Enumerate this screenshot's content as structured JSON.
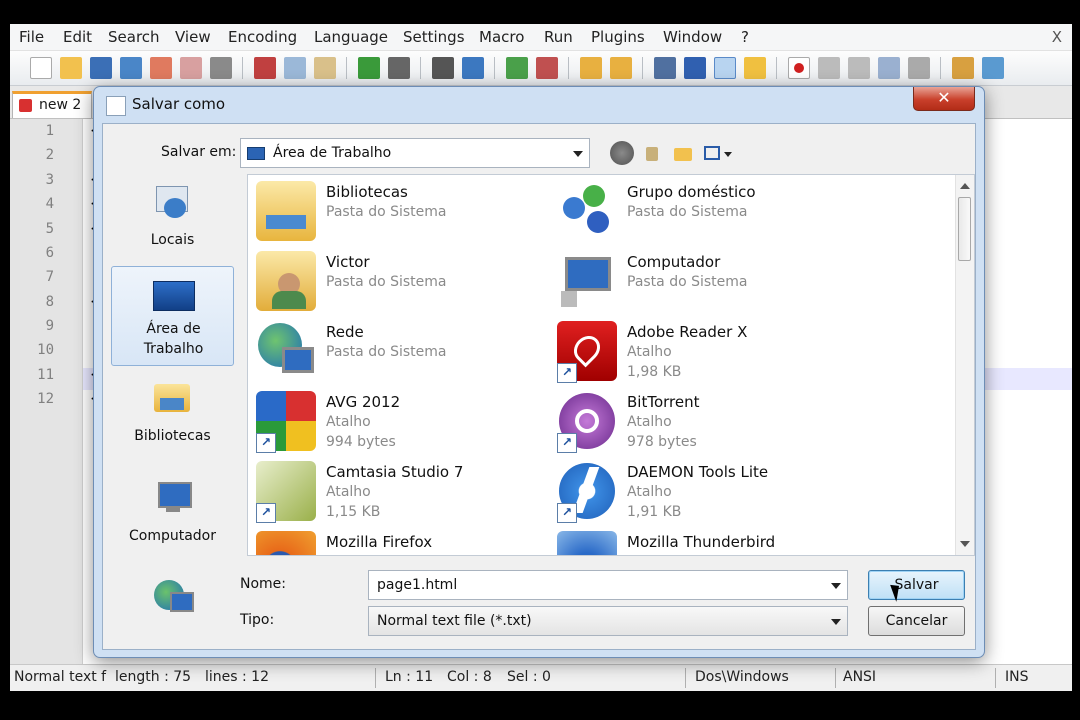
{
  "app": {
    "menu": [
      "File",
      "Edit",
      "Search",
      "View",
      "Encoding",
      "Language",
      "Settings",
      "Macro",
      "Run",
      "Plugins",
      "Window",
      "?"
    ],
    "close_glyph": "X",
    "tab_label": "new 2",
    "line_numbers": [
      "1",
      "2",
      "3",
      "4",
      "5",
      "6",
      "7",
      "8",
      "9",
      "10",
      "11",
      "12"
    ],
    "code_marks": [
      "<",
      "<",
      "<",
      "<",
      "<",
      "<",
      "<"
    ],
    "status": {
      "type": "Normal text f",
      "length": "length : 75",
      "lines": "lines : 12",
      "ln": "Ln : 11",
      "col": "Col : 8",
      "sel": "Sel : 0",
      "eol": "Dos\\Windows",
      "encoding": "ANSI",
      "mode": "INS"
    }
  },
  "dialog": {
    "title": "Salvar como",
    "close_glyph": "✕",
    "save_in_label": "Salvar em:",
    "save_in_value": "Área de Trabalho",
    "places": [
      {
        "label": "Locais",
        "icon": "recent-places-icon"
      },
      {
        "label": "Área de Trabalho",
        "icon": "desktop-icon",
        "selected": true
      },
      {
        "label": "Bibliotecas",
        "icon": "libraries-icon"
      },
      {
        "label": "Computador",
        "icon": "computer-icon"
      },
      {
        "label": "",
        "icon": "network-icon"
      }
    ],
    "files": [
      {
        "name": "Bibliotecas",
        "type": "Pasta do Sistema",
        "size": ""
      },
      {
        "name": "Grupo doméstico",
        "type": "Pasta do Sistema",
        "size": ""
      },
      {
        "name": "Victor",
        "type": "Pasta do Sistema",
        "size": ""
      },
      {
        "name": "Computador",
        "type": "Pasta do Sistema",
        "size": ""
      },
      {
        "name": "Rede",
        "type": "Pasta do Sistema",
        "size": ""
      },
      {
        "name": "Adobe Reader X",
        "type": "Atalho",
        "size": "1,98 KB"
      },
      {
        "name": "AVG 2012",
        "type": "Atalho",
        "size": "994 bytes"
      },
      {
        "name": "BitTorrent",
        "type": "Atalho",
        "size": "978 bytes"
      },
      {
        "name": "Camtasia Studio 7",
        "type": "Atalho",
        "size": "1,15 KB"
      },
      {
        "name": "DAEMON Tools Lite",
        "type": "Atalho",
        "size": "1,91 KB"
      },
      {
        "name": "Mozilla Firefox",
        "type": "",
        "size": ""
      },
      {
        "name": "Mozilla Thunderbird",
        "type": "",
        "size": ""
      }
    ],
    "name_label": "Nome:",
    "name_value": "page1.html",
    "type_label": "Tipo:",
    "type_value": "Normal text file (*.txt)",
    "save_button": "Salvar",
    "cancel_button": "Cancelar"
  },
  "colors": {
    "dialog_frame": "#cfe0f3",
    "close_red": "#c9402b",
    "tab_accent": "#f0a030",
    "primary_button": "#bfe0f6"
  }
}
